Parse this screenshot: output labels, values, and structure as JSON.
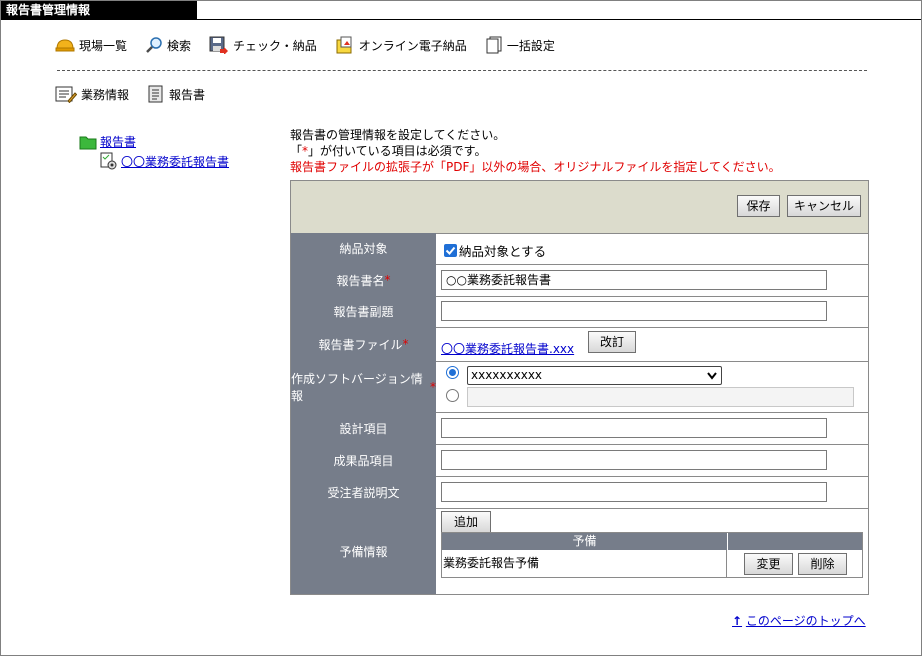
{
  "window": {
    "title": "報告書管理情報"
  },
  "toolbar": {
    "items": [
      {
        "label": "現場一覧",
        "icon": "hardhat-icon"
      },
      {
        "label": "検索",
        "icon": "magnifier-icon"
      },
      {
        "label": "チェック・納品",
        "icon": "disk-check-icon"
      },
      {
        "label": "オンライン電子納品",
        "icon": "online-delivery-icon"
      },
      {
        "label": "一括設定",
        "icon": "documents-icon"
      }
    ]
  },
  "subnav": {
    "items": [
      {
        "label": "業務情報",
        "icon": "business-info-icon"
      },
      {
        "label": "報告書",
        "icon": "report-icon"
      }
    ]
  },
  "tree": {
    "root": "報告書",
    "child": "〇〇業務委託報告書"
  },
  "messages": {
    "line1": "報告書の管理情報を設定してください。",
    "line2_pre": "「",
    "line2_ast": "*",
    "line2_post": "」が付いている項目は必須です。",
    "line3": "報告書ファイルの拡張子が「PDF」以外の場合、オリジナルファイルを指定してください。"
  },
  "buttons": {
    "save": "保存",
    "cancel": "キャンセル",
    "revise": "改訂",
    "add": "追加",
    "change": "変更",
    "delete": "削除"
  },
  "form": {
    "delivery_target": {
      "label": "納品対象",
      "checkbox_label": "納品対象とする",
      "checked": true
    },
    "report_name": {
      "label": "報告書名",
      "value": "○○業務委託報告書"
    },
    "report_subtitle": {
      "label": "報告書副題",
      "value": ""
    },
    "report_file": {
      "label": "報告書ファイル",
      "value": "〇〇業務委託報告書.xxx"
    },
    "software_version": {
      "label": "作成ソフトバージョン情報",
      "select_value": "xxxxxxxxxx",
      "text_value": ""
    },
    "design_item": {
      "label": "設計項目",
      "value": ""
    },
    "deliverable_item": {
      "label": "成果品項目",
      "value": ""
    },
    "contractor_description": {
      "label": "受注者説明文",
      "value": ""
    },
    "reserve": {
      "label": "予備情報",
      "column_header": "予備",
      "rows": [
        "業務委託報告予備"
      ]
    }
  },
  "required_mark": "*",
  "footer": {
    "top_link": "このページのトップへ",
    "arrow": "↑"
  }
}
